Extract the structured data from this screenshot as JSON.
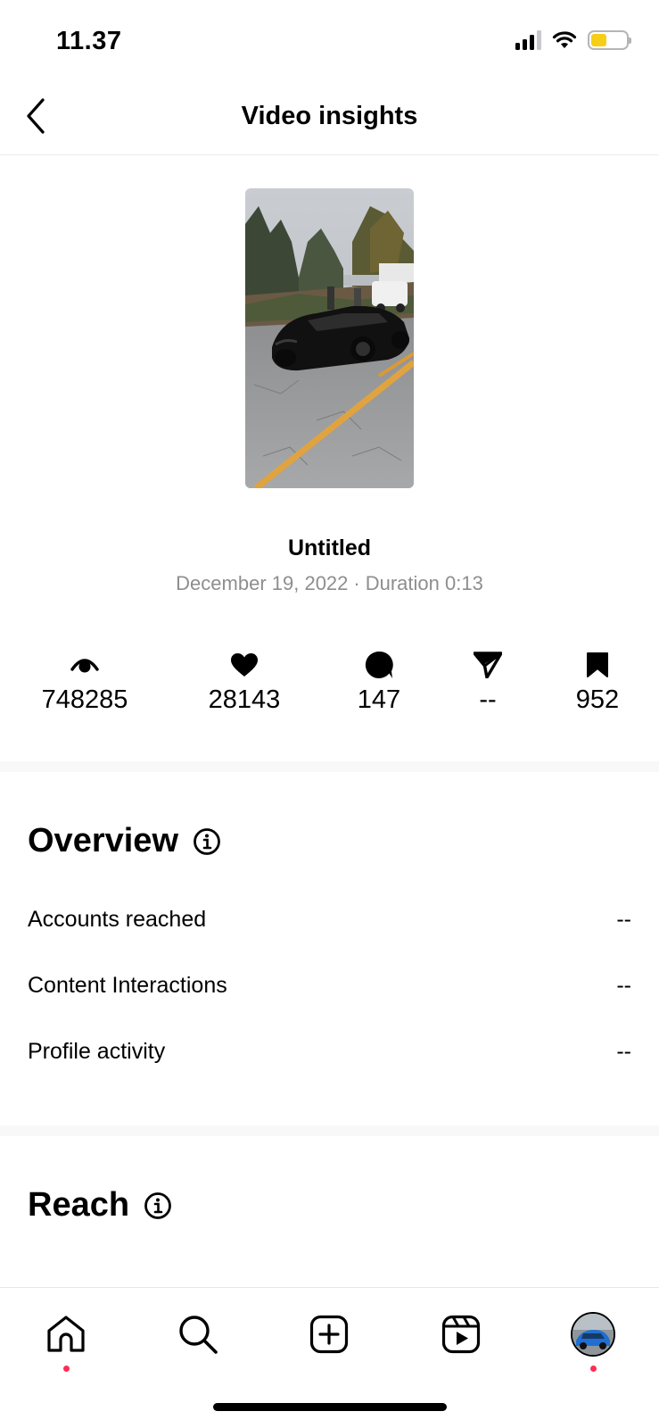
{
  "status_bar": {
    "time": "11.37",
    "icons": [
      "signal-icon",
      "wifi-icon",
      "battery-icon"
    ],
    "battery_level": 0.45,
    "battery_color": "#f7ce16"
  },
  "header": {
    "title": "Video insights",
    "back_icon": "chevron-left-icon"
  },
  "video": {
    "title": "Untitled",
    "date": "December 19, 2022",
    "separator": "·",
    "duration": "Duration 0:13"
  },
  "stats": [
    {
      "icon": "views-eye-icon",
      "value": "748285"
    },
    {
      "icon": "heart-icon",
      "value": "28143"
    },
    {
      "icon": "comment-icon",
      "value": "147"
    },
    {
      "icon": "share-send-icon",
      "value": "--"
    },
    {
      "icon": "bookmark-icon",
      "value": "952"
    }
  ],
  "overview": {
    "title": "Overview",
    "rows": [
      {
        "label": "Accounts reached",
        "value": "--"
      },
      {
        "label": "Content Interactions",
        "value": "--"
      },
      {
        "label": "Profile activity",
        "value": "--"
      }
    ]
  },
  "reach": {
    "title": "Reach"
  },
  "tab_bar": {
    "tabs": [
      "home-icon",
      "search-icon",
      "create-icon",
      "reels-icon",
      "profile-avatar"
    ],
    "notification_color": "#ff2d55"
  }
}
